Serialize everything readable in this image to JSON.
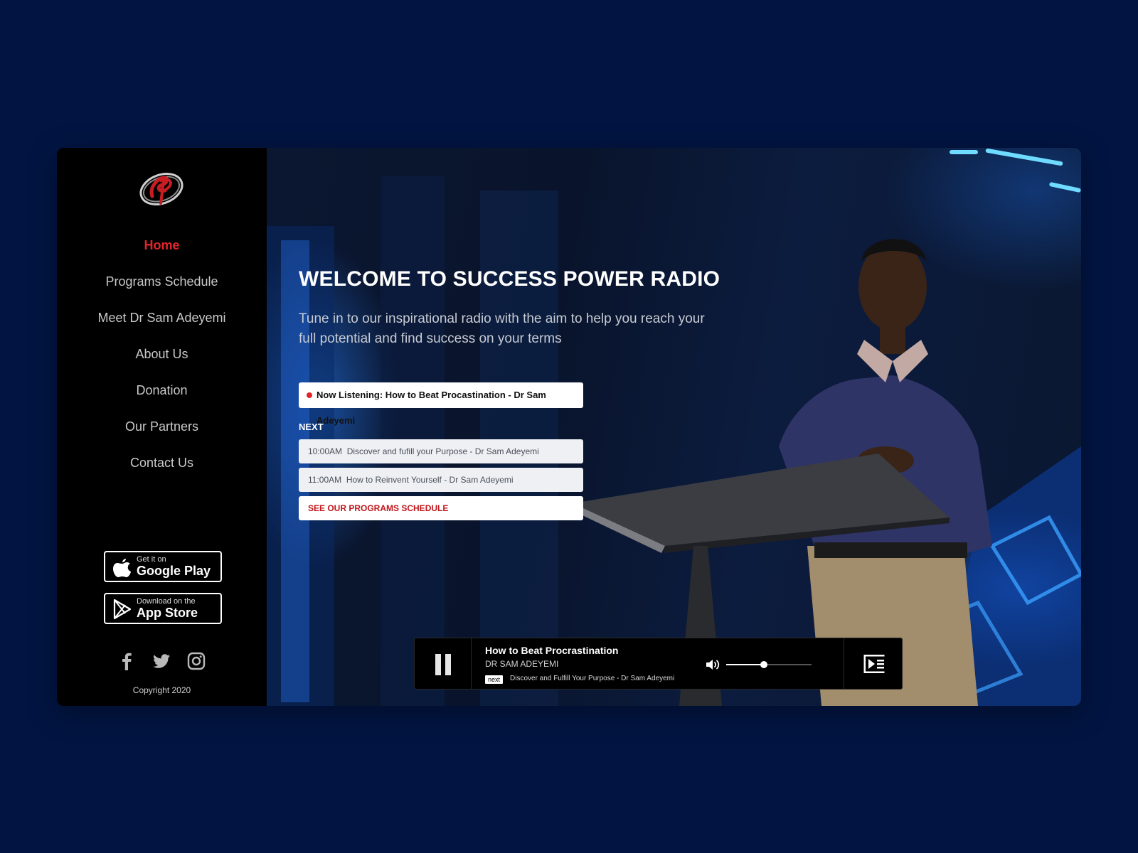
{
  "sidebar": {
    "nav": [
      "Home",
      "Programs Schedule",
      "Meet Dr Sam Adeyemi",
      "About Us",
      "Donation",
      "Our Partners",
      "Contact Us"
    ],
    "active_item": "Home",
    "google_play": {
      "small": "Get it on",
      "big": "Google Play"
    },
    "app_store": {
      "small": "Download on the",
      "big": "App Store"
    },
    "social": [
      "facebook-icon",
      "twitter-icon",
      "instagram-icon"
    ],
    "copyright": "Copyright 2020"
  },
  "hero": {
    "title": "WELCOME TO SUCCESS POWER RADIO",
    "subtitle": "Tune in to our inspirational radio with the aim to help you reach your full potential and find success on your terms",
    "now_listening": "Now Listening: How to Beat Procastination - Dr Sam Adeyemi",
    "next_label": "NEXT",
    "schedule": [
      {
        "time": "10:00AM",
        "title": "Discover and fufill your Purpose - Dr Sam Adeyemi"
      },
      {
        "time": "11:00AM",
        "title": "How to Reinvent Yourself  - Dr Sam Adeyemi"
      }
    ],
    "schedule_link": "SEE OUR PROGRAMS SCHEDULE"
  },
  "player": {
    "track": "How to Beat Procrastination",
    "artist": "DR SAM ADEYEMI",
    "next_tag": "next",
    "next_text": "Discover and Fulfill Your Purpose - Dr Sam Adeyemi",
    "volume": 0.44,
    "state": "playing"
  },
  "colors": {
    "page_bg": "#021542",
    "accent_red": "#e0262b",
    "sidebar_bg": "#000000"
  }
}
